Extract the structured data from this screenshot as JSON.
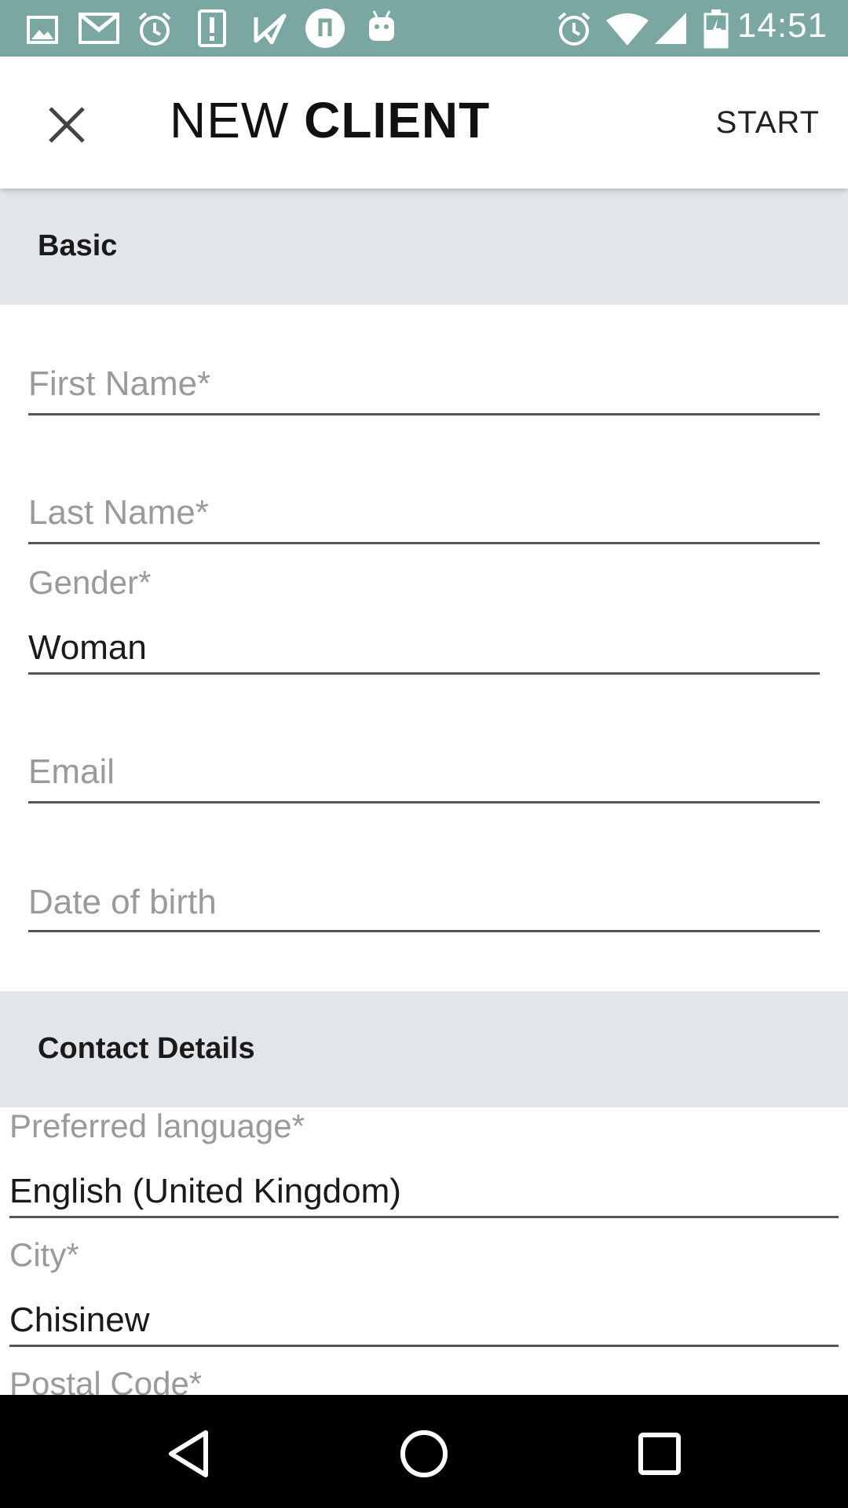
{
  "status_bar": {
    "time": "14:51",
    "left_icons": [
      "image-icon",
      "gmail-icon",
      "alarm-icon",
      "alert-icon",
      "check-icon",
      "music-icon",
      "android-icon"
    ],
    "right_icons": [
      "alarm-icon",
      "wifi-icon",
      "signal-icon",
      "battery-icon"
    ],
    "color": "#7aa7a1"
  },
  "header": {
    "title_light": "NEW",
    "title_bold": "CLIENT",
    "start_label": "START"
  },
  "sections": {
    "basic": "Basic",
    "contact": "Contact Details"
  },
  "basic_fields": {
    "first_name": {
      "placeholder": "First Name*"
    },
    "last_name": {
      "placeholder": "Last Name*"
    },
    "gender": {
      "label": "Gender*",
      "value": "Woman"
    },
    "email": {
      "placeholder": "Email"
    },
    "dob": {
      "placeholder": "Date of birth"
    }
  },
  "contact_fields": {
    "language": {
      "label": "Preferred language*",
      "value": "English (United Kingdom)"
    },
    "city": {
      "label": "City*",
      "value": "Chisinew"
    },
    "postal": {
      "label": "Postal Code*"
    }
  },
  "nav": [
    "back-icon",
    "home-icon",
    "recents-icon"
  ]
}
